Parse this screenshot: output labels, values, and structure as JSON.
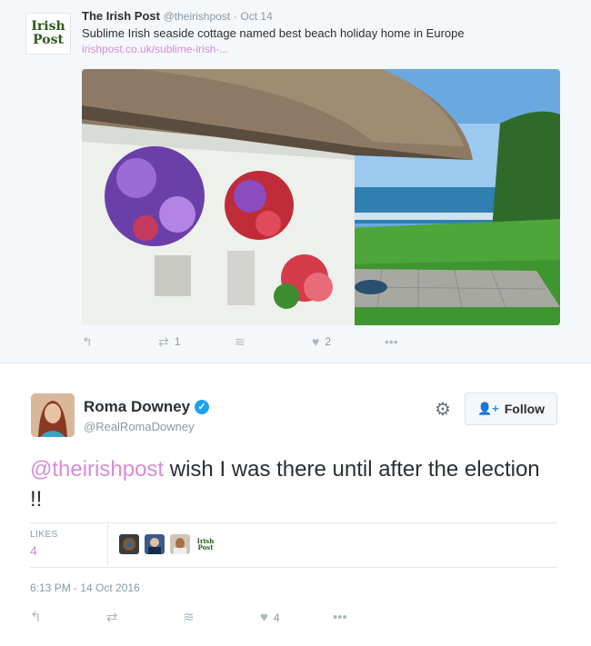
{
  "quoted_tweet": {
    "logo_line1": "Irish",
    "logo_line2": "Post",
    "name": "The Irish Post",
    "handle": "@theirishpost",
    "separator": "·",
    "date": "Oct 14",
    "text": "Sublime Irish seaside cottage named best beach holiday home in Europe",
    "link": "irishpost.co.uk/sublime-irish-...",
    "retweets": "1",
    "likes": "2",
    "icons": [
      "reply-icon",
      "retweet-icon",
      "stack-icon",
      "heart-icon",
      "more-icon"
    ]
  },
  "tweet": {
    "author_name": "Roma Downey",
    "verified": "✓",
    "handle": "@RealRomaDowney",
    "follow_label": "Follow",
    "mention": "@theirishpost",
    "text_rest": " wish I was there until after the election !!",
    "likes_label": "LIKES",
    "likes_count": "4",
    "liker_logo_line1": "Irish",
    "liker_logo_line2": "Post",
    "timestamp": "6:13 PM - 14 Oct 2016",
    "action_likes": "4"
  },
  "colors": {
    "accent": "#1b95e0",
    "link_pink": "#d78cd6",
    "muted": "#8899a6",
    "quoted_bg": "#f5f8fa"
  }
}
